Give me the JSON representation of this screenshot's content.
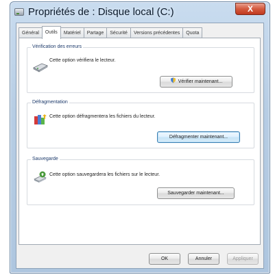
{
  "window": {
    "title": "Propriétés de : Disque local (C:)",
    "close_label": "X"
  },
  "tabs": [
    {
      "label": "Général",
      "active": false
    },
    {
      "label": "Outils",
      "active": true
    },
    {
      "label": "Matériel",
      "active": false
    },
    {
      "label": "Partage",
      "active": false
    },
    {
      "label": "Sécurité",
      "active": false
    },
    {
      "label": "Versions précédentes",
      "active": false
    },
    {
      "label": "Quota",
      "active": false
    }
  ],
  "groups": {
    "check": {
      "title": "Vérification des erreurs",
      "description": "Cette option vérifiera le lecteur.",
      "button": "Vérifier maintenant...",
      "icon": "drive-check-icon"
    },
    "defrag": {
      "title": "Défragmentation",
      "description": "Cette option défragmentera les fichiers du lecteur.",
      "button": "Défragmenter maintenant...",
      "icon": "defrag-icon"
    },
    "backup": {
      "title": "Sauvegarde",
      "description": "Cette option sauvegardera les fichiers sur le lecteur.",
      "button": "Sauvegarder maintenant...",
      "icon": "backup-icon"
    }
  },
  "dialog_buttons": {
    "ok": "OK",
    "cancel": "Annuler",
    "apply": "Appliquer"
  },
  "colors": {
    "accent": "#3c7fb1",
    "close": "#c0391f"
  }
}
